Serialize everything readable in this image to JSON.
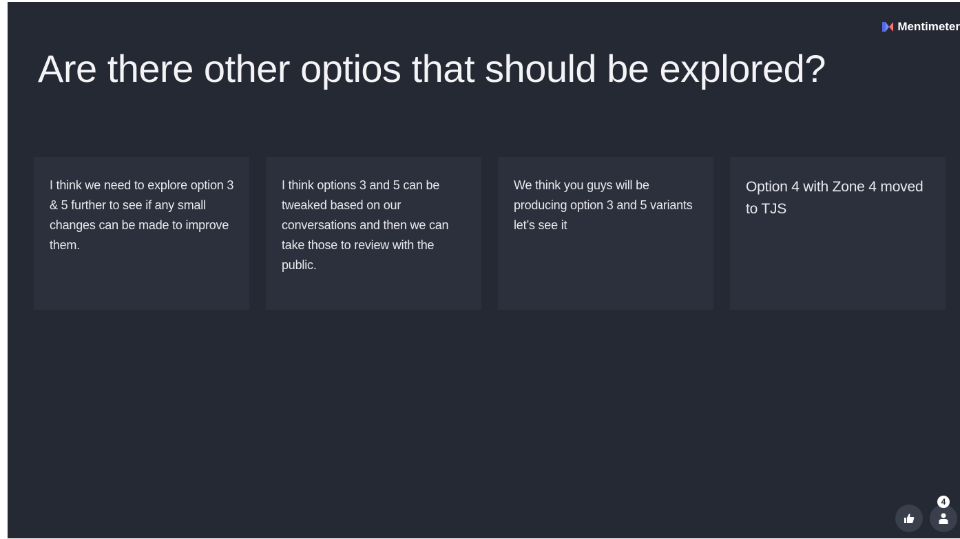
{
  "brand": {
    "name": "Mentimeter",
    "logo_colors": [
      "#5769e7",
      "#ff7171"
    ]
  },
  "slide": {
    "title": "Are there other optios that should be explored?",
    "responses": [
      {
        "text": "I think we need to explore option 3 & 5 further to see if any small changes can be made to improve them."
      },
      {
        "text": "I think options 3 and 5 can be tweaked based on our conversations and then we can take those to review with the public."
      },
      {
        "text": "We think you guys will be producing option 3 and 5 variants let’s see it"
      },
      {
        "text": "Option 4 with Zone 4 moved to TJS"
      }
    ]
  },
  "footer": {
    "like_icon": "thumbs-up-icon",
    "participants_icon": "person-icon",
    "participant_count": "4"
  },
  "colors": {
    "background": "#252934",
    "card": "#2c303c",
    "text": "#f4f4f6"
  }
}
